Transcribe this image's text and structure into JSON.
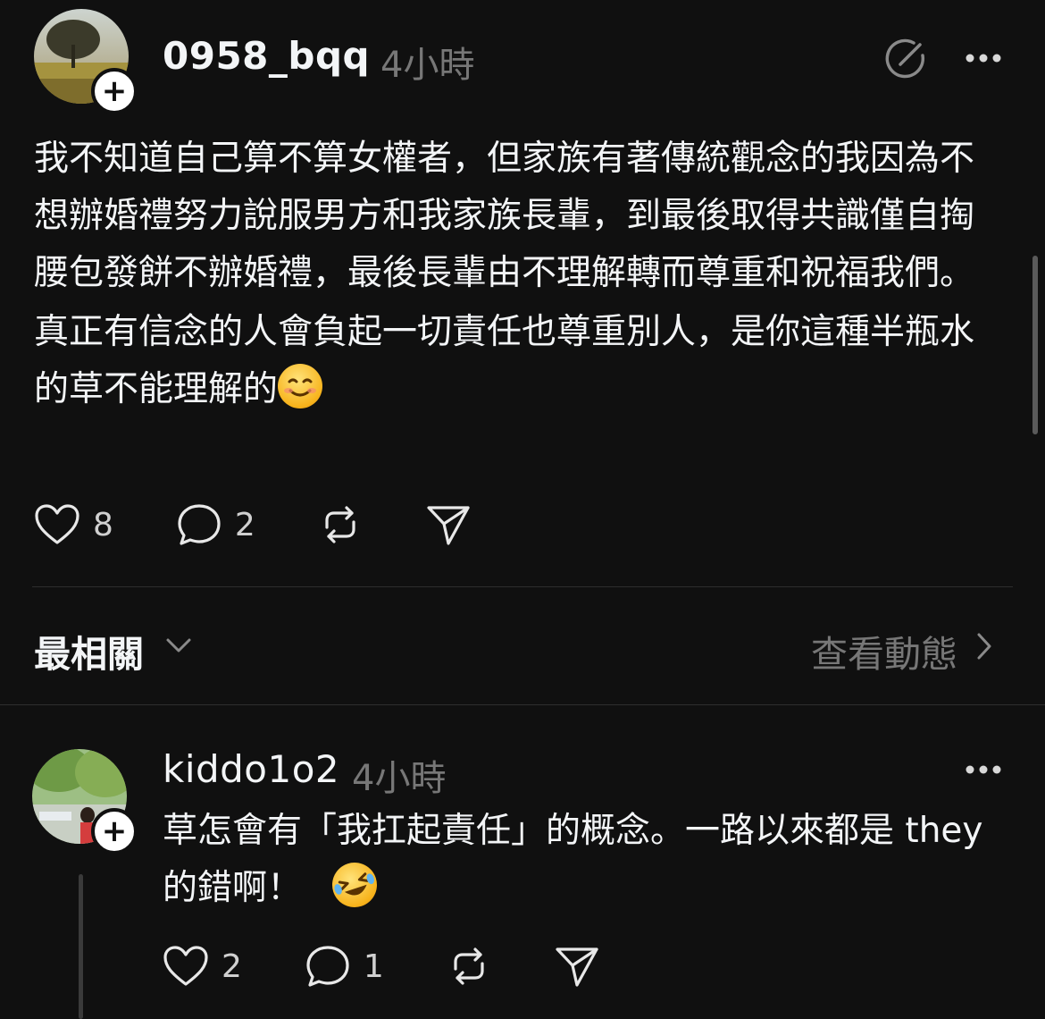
{
  "post": {
    "username": "0958_bqq",
    "timestamp": "4小時",
    "paragraphs": [
      "我不知道自己算不算女權者，但家族有著傳統觀念的我因為不想辦婚禮努力說服男方和我家族長輩，到最後取得共識僅自掏腰包發餅不辦婚禮，最後長輩由不理解轉而尊重和祝福我們。",
      "真正有信念的人會負起一切責任也尊重別人，是你這種半瓶水的草不能理解的"
    ],
    "emoji": "smiling-face-icon",
    "likes": "8",
    "replies": "2",
    "follow_symbol": "+"
  },
  "sort": {
    "label": "最相關",
    "activity_link": "查看動態"
  },
  "reply": {
    "username": "kiddo1o2",
    "timestamp": "4小時",
    "text": "草怎會有「我扛起責任」的概念。一路以來都是 they 的錯啊！",
    "emoji": "rolling-laughing-icon",
    "likes": "2",
    "replies": "1",
    "follow_symbol": "+"
  },
  "icons": {
    "compose": "compose-icon",
    "more": "more-icon",
    "like": "heart-icon",
    "reply": "comment-icon",
    "repost": "repost-icon",
    "share": "send-icon"
  }
}
